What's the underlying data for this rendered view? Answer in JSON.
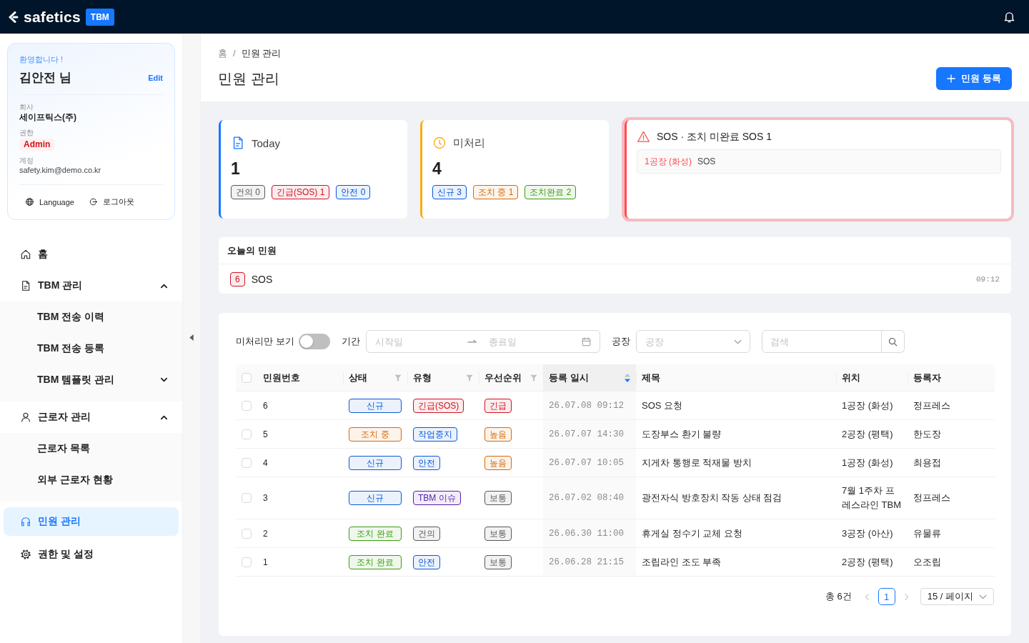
{
  "header": {
    "logo": "safetics",
    "badge": "TBM"
  },
  "profile": {
    "greeting": "환영합니다 !",
    "name": "김안전 님",
    "edit": "Edit",
    "fields": [
      {
        "label": "회사",
        "value": "세이프틱스(주)",
        "kind": "strong"
      },
      {
        "label": "권한",
        "value": "Admin",
        "kind": "badge"
      },
      {
        "label": "계정",
        "value": "safety.kim@demo.co.kr",
        "kind": "plain"
      }
    ],
    "actions": [
      "Language",
      "로그아웃"
    ]
  },
  "nav": {
    "items": [
      {
        "label": "홈",
        "selected": false
      },
      {
        "label": "TBM 관리",
        "selected": false,
        "expanded": true,
        "children": [
          {
            "label": "TBM 전송 이력",
            "selected": false
          },
          {
            "label": "TBM 전송 등록",
            "selected": false
          },
          {
            "label": "TBM 템플릿 관리",
            "selected": false,
            "expanded": false
          }
        ]
      },
      {
        "label": "근로자 관리",
        "selected": false,
        "expanded": true,
        "children": [
          {
            "label": "근로자 목록",
            "selected": false
          },
          {
            "label": "외부 근로자 현황",
            "selected": false
          }
        ]
      },
      {
        "label": "민원 관리",
        "selected": true
      },
      {
        "label": "권한 및 설정",
        "selected": false
      }
    ]
  },
  "page": {
    "breadcrumb": [
      "홈",
      "민원 관리"
    ],
    "breadcrumb_separator": "/",
    "title": "민원 관리",
    "primary_button": "민원 등록"
  },
  "summary_cards": [
    {
      "kind": "count",
      "title": "Today",
      "value": "1",
      "color": "#1677ff",
      "tags": [
        {
          "label": "건의 0",
          "color": "#595959"
        },
        {
          "label": "긴급(SOS) 1",
          "color": "#cf1322"
        },
        {
          "label": "안전 0",
          "color": "#0958d9"
        }
      ]
    },
    {
      "kind": "count",
      "title": "미처리",
      "value": "4",
      "color": "#faad14",
      "tags": [
        {
          "label": "신규 3",
          "color": "#0958d9"
        },
        {
          "label": "조치 중 1",
          "color": "#d46b08"
        },
        {
          "label": "조치완료 2",
          "color": "#389e0d"
        }
      ]
    },
    {
      "kind": "alert",
      "title": "SOS · 조치 미완료 SOS 1",
      "color": "#ff4d4f",
      "items": [
        {
          "location": "1공장 (화성)",
          "type": "SOS"
        }
      ]
    }
  ],
  "today": {
    "title": "오늘의 민원",
    "items": [
      {
        "number": "6",
        "type": "SOS",
        "time": "09:12",
        "color": "#cf1322"
      }
    ]
  },
  "filters": {
    "unprocessed_toggle": {
      "label": "미처리만 보기",
      "on": false
    },
    "period": {
      "label": "기간",
      "start_placeholder": "시작일",
      "end_placeholder": "종료일"
    },
    "factory": {
      "label": "공장",
      "placeholder": "공장"
    },
    "search": {
      "placeholder": "검색"
    }
  },
  "table": {
    "select_all": {
      "checked": false
    },
    "columns": [
      {
        "label": "민원번호",
        "filterable": false,
        "sorted": false
      },
      {
        "label": "상태",
        "filterable": true,
        "sorted": false
      },
      {
        "label": "유형",
        "filterable": true,
        "sorted": false
      },
      {
        "label": "우선순위",
        "filterable": true,
        "sorted": false
      },
      {
        "label": "등록 일시",
        "filterable": false,
        "sorted": true,
        "sort_descending": true
      },
      {
        "label": "제목",
        "filterable": false,
        "sorted": false
      },
      {
        "label": "위치",
        "filterable": false,
        "sorted": false
      },
      {
        "label": "등록자",
        "filterable": false,
        "sorted": false
      }
    ],
    "rows": [
      {
        "checked": false,
        "number": "6",
        "status": {
          "label": "신규",
          "color": "#0958d9"
        },
        "type": {
          "label": "긴급(SOS)",
          "color": "#cf1322"
        },
        "priority": {
          "label": "긴급",
          "color": "#cf1322"
        },
        "datetime": "26.07.08 09:12",
        "title": "SOS 요청",
        "location": "1공장 (화성)",
        "author": "정프레스"
      },
      {
        "checked": false,
        "number": "5",
        "status": {
          "label": "조치 중",
          "color": "#d46b08"
        },
        "type": {
          "label": "작업중지",
          "color": "#0958d9"
        },
        "priority": {
          "label": "높음",
          "color": "#d46b08"
        },
        "datetime": "26.07.07 14:30",
        "title": "도장부스 환기 불량",
        "location": "2공장 (평택)",
        "author": "한도장"
      },
      {
        "checked": false,
        "number": "4",
        "status": {
          "label": "신규",
          "color": "#0958d9"
        },
        "type": {
          "label": "안전",
          "color": "#0958d9"
        },
        "priority": {
          "label": "높음",
          "color": "#d46b08"
        },
        "datetime": "26.07.07 10:05",
        "title": "지게차 통행로 적재물 방치",
        "location": "1공장 (화성)",
        "author": "최용접"
      },
      {
        "checked": false,
        "number": "3",
        "status": {
          "label": "신규",
          "color": "#0958d9"
        },
        "type": {
          "label": "TBM 이슈",
          "color": "#531dab"
        },
        "priority": {
          "label": "보통",
          "color": "#595959"
        },
        "datetime": "26.07.02 08:40",
        "title": "광전자식 방호장치 작동 상태 점검",
        "location": "7월 1주차 프레스라인 TBM",
        "author": "정프레스"
      },
      {
        "checked": false,
        "number": "2",
        "status": {
          "label": "조치 완료",
          "color": "#389e0d"
        },
        "type": {
          "label": "건의",
          "color": "#595959"
        },
        "priority": {
          "label": "보통",
          "color": "#595959"
        },
        "datetime": "26.06.30 11:00",
        "title": "휴게실 정수기 교체 요청",
        "location": "3공장 (아산)",
        "author": "유물류"
      },
      {
        "checked": false,
        "number": "1",
        "status": {
          "label": "조치 완료",
          "color": "#389e0d"
        },
        "type": {
          "label": "안전",
          "color": "#0958d9"
        },
        "priority": {
          "label": "보통",
          "color": "#595959"
        },
        "datetime": "26.06.28 21:15",
        "title": "조립라인 조도 부족",
        "location": "2공장 (평택)",
        "author": "오조립"
      }
    ]
  },
  "pagination": {
    "total": "총 6건",
    "prev": {
      "disabled": true
    },
    "pages": [
      {
        "label": "1",
        "selected": true
      }
    ],
    "next": {
      "disabled": true
    },
    "page_size": "15 / 페이지"
  }
}
